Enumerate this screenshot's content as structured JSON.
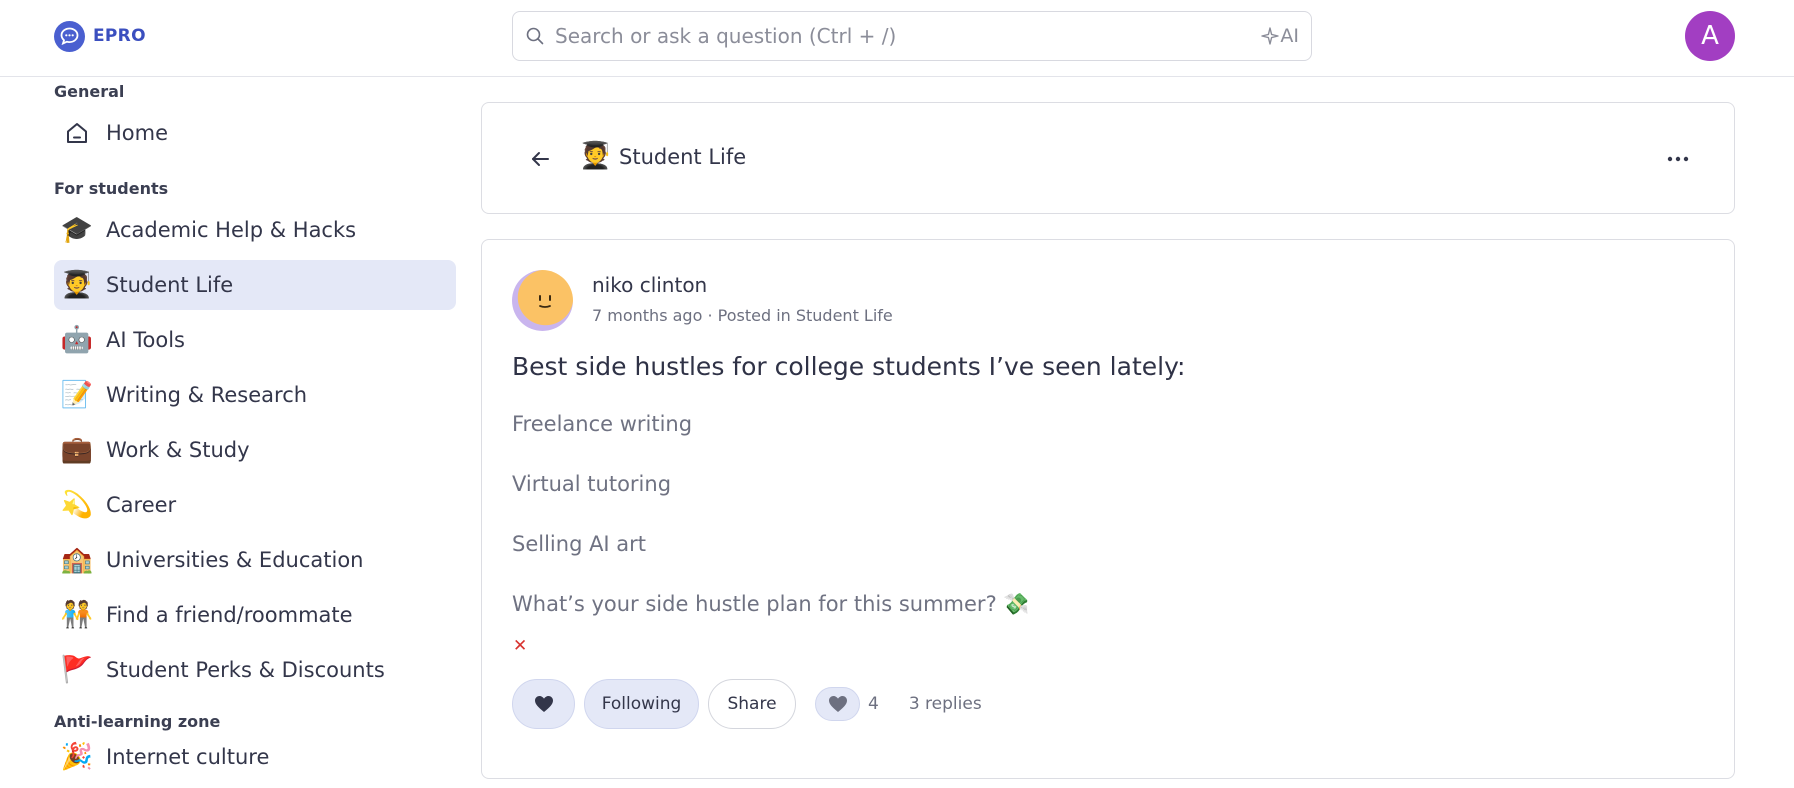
{
  "header": {
    "brand": "EPRO",
    "search_placeholder": "Search or ask a question (Ctrl + /)",
    "ai_label": "AI",
    "avatar_initial": "A"
  },
  "sidebar": {
    "sections": [
      {
        "label": "General",
        "items": [
          {
            "label": "Home",
            "icon": "home-icon"
          }
        ]
      },
      {
        "label": "For students",
        "items": [
          {
            "label": "Academic Help & Hacks",
            "icon": "🎓"
          },
          {
            "label": "Student Life",
            "icon": "🧑‍🎓",
            "active": true
          },
          {
            "label": "AI Tools",
            "icon": "🤖"
          },
          {
            "label": "Writing & Research",
            "icon": "📝"
          },
          {
            "label": "Work & Study",
            "icon": "💼"
          },
          {
            "label": "Career",
            "icon": "💫"
          },
          {
            "label": "Universities & Education",
            "icon": "🏫"
          },
          {
            "label": "Find a friend/roommate",
            "icon": "🧑‍🤝‍🧑"
          },
          {
            "label": "Student Perks & Discounts",
            "icon": "🚩"
          }
        ]
      },
      {
        "label": "Anti-learning zone",
        "items": [
          {
            "label": "Internet culture",
            "icon": "🎉"
          }
        ]
      }
    ]
  },
  "channel": {
    "emoji": "🧑‍🎓",
    "title": "Student Life"
  },
  "post": {
    "author": "niko clinton",
    "meta": "7 months ago · Posted in Student Life",
    "title": "Best side hustles for college students I’ve seen lately:",
    "paragraphs": [
      "Freelance writing",
      "Virtual tutoring",
      "Selling AI art",
      "What’s your side hustle plan for this summer? 💸"
    ],
    "close_glyph": "✕",
    "following_label": "Following",
    "share_label": "Share",
    "like_count": "4",
    "replies_label": "3 replies"
  },
  "colors": {
    "brand": "#3b4fbf",
    "avatar": "#a23ec2",
    "active_bg": "#e4e8f7"
  }
}
